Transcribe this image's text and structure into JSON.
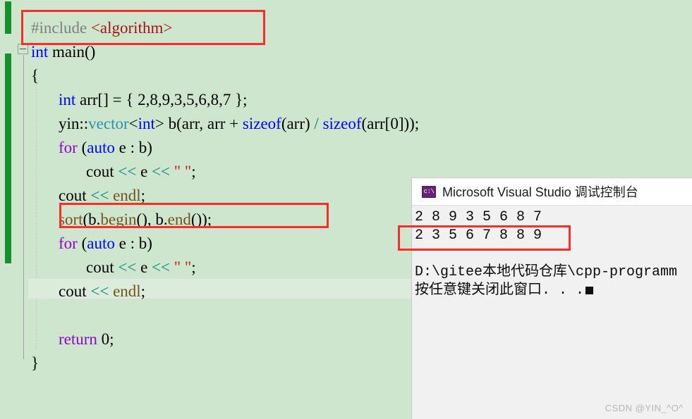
{
  "editor": {
    "background_color": "#cde6cd",
    "change_bar_color": "#16902a",
    "lines": [
      {
        "id": "line-include",
        "indent": 0,
        "tokens": [
          {
            "cls": "t-pre",
            "text": "#include "
          },
          {
            "cls": "t-hdr",
            "text": "<algorithm>"
          }
        ]
      },
      {
        "id": "line-main",
        "indent": 0,
        "tokens": [
          {
            "cls": "t-kw",
            "text": "int"
          },
          {
            "cls": "t-plain",
            "text": " main()"
          }
        ]
      },
      {
        "id": "line-open-brace",
        "indent": 0,
        "tokens": [
          {
            "cls": "t-plain",
            "text": "{"
          }
        ]
      },
      {
        "id": "line-arr-decl",
        "indent": 1,
        "tokens": [
          {
            "cls": "t-kw",
            "text": "int"
          },
          {
            "cls": "t-plain",
            "text": " arr[] = { 2,8,9,3,5,6,8,7 };"
          }
        ]
      },
      {
        "id": "line-vector-decl",
        "indent": 1,
        "tokens": [
          {
            "cls": "t-plain",
            "text": "yin::"
          },
          {
            "cls": "t-type",
            "text": "vector"
          },
          {
            "cls": "t-plain",
            "text": "<"
          },
          {
            "cls": "t-kw",
            "text": "int"
          },
          {
            "cls": "t-plain",
            "text": "> b(arr, arr + "
          },
          {
            "cls": "t-kw",
            "text": "sizeof"
          },
          {
            "cls": "t-plain",
            "text": "(arr) "
          },
          {
            "cls": "t-op",
            "text": "/"
          },
          {
            "cls": "t-plain",
            "text": " "
          },
          {
            "cls": "t-kw",
            "text": "sizeof"
          },
          {
            "cls": "t-plain",
            "text": "(arr[0]));"
          }
        ]
      },
      {
        "id": "line-for-1",
        "indent": 1,
        "tokens": [
          {
            "cls": "t-ctrl",
            "text": "for"
          },
          {
            "cls": "t-plain",
            "text": " ("
          },
          {
            "cls": "t-kw",
            "text": "auto"
          },
          {
            "cls": "t-plain",
            "text": " e : b)"
          }
        ]
      },
      {
        "id": "line-cout-e-1",
        "indent": 2,
        "tokens": [
          {
            "cls": "t-plain",
            "text": "cout "
          },
          {
            "cls": "t-op",
            "text": "<<"
          },
          {
            "cls": "t-plain",
            "text": " e "
          },
          {
            "cls": "t-op",
            "text": "<<"
          },
          {
            "cls": "t-plain",
            "text": " "
          },
          {
            "cls": "t-str",
            "text": "\" \""
          },
          {
            "cls": "t-plain",
            "text": ";"
          }
        ]
      },
      {
        "id": "line-cout-endl-1",
        "indent": 1,
        "tokens": [
          {
            "cls": "t-plain",
            "text": "cout "
          },
          {
            "cls": "t-op",
            "text": "<<"
          },
          {
            "cls": "t-plain",
            "text": " "
          },
          {
            "cls": "t-fn",
            "text": "endl"
          },
          {
            "cls": "t-plain",
            "text": ";"
          }
        ]
      },
      {
        "id": "line-sort",
        "indent": 1,
        "tokens": [
          {
            "cls": "t-fn",
            "text": "sort"
          },
          {
            "cls": "t-plain",
            "text": "(b."
          },
          {
            "cls": "t-fn",
            "text": "begin"
          },
          {
            "cls": "t-plain",
            "text": "(), b."
          },
          {
            "cls": "t-fn",
            "text": "end"
          },
          {
            "cls": "t-plain",
            "text": "());"
          }
        ]
      },
      {
        "id": "line-for-2",
        "indent": 1,
        "tokens": [
          {
            "cls": "t-ctrl",
            "text": "for"
          },
          {
            "cls": "t-plain",
            "text": " ("
          },
          {
            "cls": "t-kw",
            "text": "auto"
          },
          {
            "cls": "t-plain",
            "text": " e : b)"
          }
        ]
      },
      {
        "id": "line-cout-e-2",
        "indent": 2,
        "tokens": [
          {
            "cls": "t-plain",
            "text": "cout "
          },
          {
            "cls": "t-op",
            "text": "<<"
          },
          {
            "cls": "t-plain",
            "text": " e "
          },
          {
            "cls": "t-op",
            "text": "<<"
          },
          {
            "cls": "t-plain",
            "text": " "
          },
          {
            "cls": "t-str",
            "text": "\" \""
          },
          {
            "cls": "t-plain",
            "text": ";"
          }
        ]
      },
      {
        "id": "line-cout-endl-2",
        "indent": 1,
        "tokens": [
          {
            "cls": "t-plain",
            "text": "cout "
          },
          {
            "cls": "t-op",
            "text": "<<"
          },
          {
            "cls": "t-plain",
            "text": " "
          },
          {
            "cls": "t-fn",
            "text": "endl"
          },
          {
            "cls": "t-plain",
            "text": ";"
          }
        ]
      },
      {
        "id": "line-empty",
        "indent": 0,
        "tokens": []
      },
      {
        "id": "line-return",
        "indent": 1,
        "tokens": [
          {
            "cls": "t-ctrl",
            "text": "return"
          },
          {
            "cls": "t-plain",
            "text": " 0;"
          }
        ]
      },
      {
        "id": "line-close-brace",
        "indent": 0,
        "tokens": [
          {
            "cls": "t-plain",
            "text": "}"
          }
        ]
      }
    ]
  },
  "annotations": {
    "color": "#fb2c2c",
    "boxes": [
      {
        "id": "redbox-include",
        "target": "#include <algorithm>"
      },
      {
        "id": "redbox-sort",
        "target": "sort(b.begin(), b.end());"
      },
      {
        "id": "redbox-output",
        "target": "2 3 5 6 7 8 8 9"
      }
    ]
  },
  "console": {
    "icon_name": "cmd-prompt-icon",
    "icon_label": "c:\\",
    "icon_color": "#68217a",
    "title": "Microsoft Visual Studio 调试控制台",
    "lines": [
      {
        "id": "console-line-unsorted",
        "text": "2 8 9 3 5 6 8 7"
      },
      {
        "id": "console-line-sorted",
        "text": "2 3 5 6 7 8 8 9"
      },
      {
        "id": "console-line-blank",
        "text": ""
      },
      {
        "id": "console-line-path",
        "text": "D:\\gitee本地代码仓库\\cpp-programm"
      },
      {
        "id": "console-line-prompt",
        "text": "按任意键关闭此窗口. . ."
      }
    ]
  },
  "watermark": {
    "text": "CSDN @YIN_^O^"
  }
}
